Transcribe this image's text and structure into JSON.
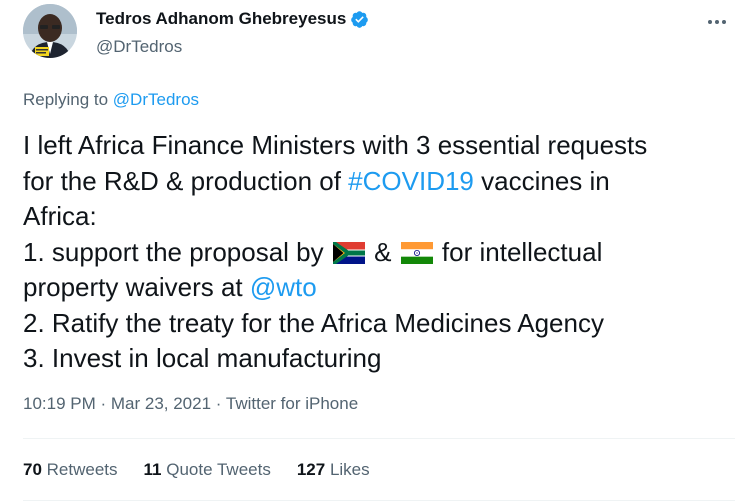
{
  "author": {
    "name": "Tedros Adhanom Ghebreyesus",
    "handle": "@DrTedros",
    "avatar_icon": "profile-photo",
    "verified_icon": "verified-badge-icon"
  },
  "reply": {
    "prefix": "Replying to",
    "handle": "@DrTedros"
  },
  "tweet": {
    "line1": "I left Africa Finance Ministers with 3 essential requests",
    "line2_pre": "for the R&D & production of ",
    "line2_hashtag": "#COVID19",
    "line2_post": " vaccines in",
    "line3": "Africa:",
    "line4_pre": "1. support the proposal by",
    "line4_mid": "&",
    "line4_post": "for intellectual",
    "line5_pre": "property waivers at ",
    "line5_mention": "@wto",
    "line6": "2. Ratify the treaty for the Africa Medicines Agency",
    "line7": "3. Invest in local manufacturing"
  },
  "flags": {
    "first": "south-africa-flag-icon",
    "second": "india-flag-icon"
  },
  "meta": {
    "time": "10:19 PM",
    "sep1": " · ",
    "date": "Mar 23, 2021",
    "sep2": " · ",
    "app": "Twitter for iPhone"
  },
  "stats": {
    "retweets_count": "70",
    "retweets_label": "Retweets",
    "quotes_count": "11",
    "quotes_label": "Quote Tweets",
    "likes_count": "127",
    "likes_label": "Likes"
  },
  "colors": {
    "link": "#1d9bf0",
    "secondary_text": "#536471",
    "primary_text": "#0f1419",
    "divider": "#eff3f4"
  }
}
